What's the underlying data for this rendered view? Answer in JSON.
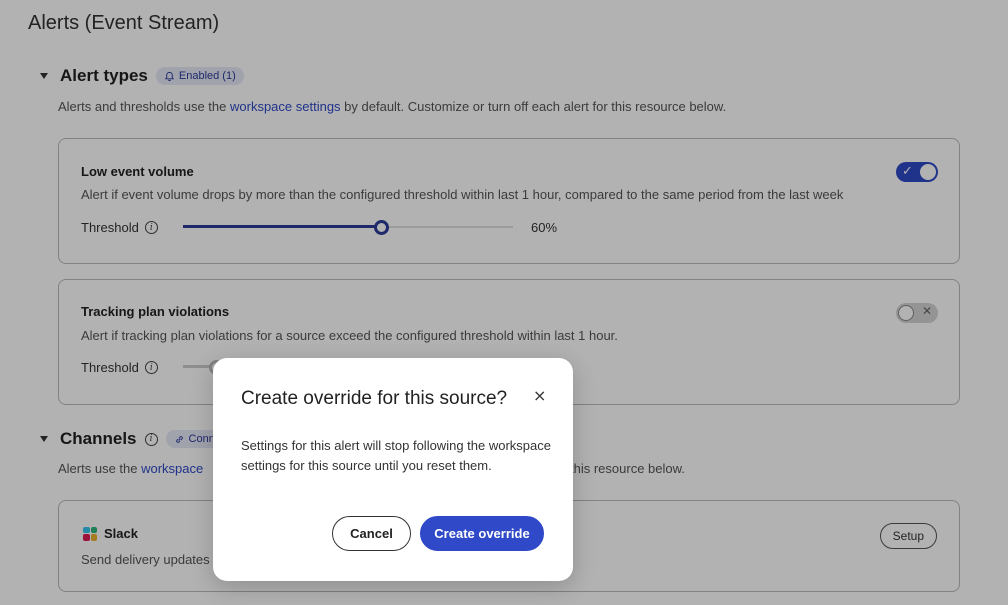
{
  "page": {
    "title": "Alerts (Event Stream)"
  },
  "alert_types": {
    "title": "Alert types",
    "badge": "Enabled (1)",
    "desc_before": "Alerts and thresholds use the ",
    "desc_link": "workspace settings",
    "desc_after": " by default. Customize or turn off each alert for this resource below.",
    "cards": [
      {
        "title": "Low event volume",
        "desc": "Alert if event volume drops by more than the configured threshold within last 1 hour, compared to the same period from the last week",
        "threshold_label": "Threshold",
        "threshold_value": "60%",
        "threshold_fraction": 0.6,
        "enabled": true,
        "toggle_glyph": "✓"
      },
      {
        "title": "Tracking plan violations",
        "desc": "Alert if tracking plan violations for a source exceed the configured threshold within last 1 hour.",
        "threshold_label": "Threshold",
        "threshold_fraction": 0.1,
        "enabled": false,
        "toggle_glyph": "✕"
      }
    ]
  },
  "channels": {
    "title": "Channels",
    "badge": "Conn",
    "desc_before": "Alerts use the ",
    "desc_link": "workspace",
    "desc_after": "this resource below.",
    "slack": {
      "name": "Slack",
      "desc": "Send delivery updates",
      "setup_label": "Setup"
    }
  },
  "modal": {
    "title": "Create override for this source?",
    "close_glyph": "×",
    "body": "Settings for this alert will stop following the workspace settings for this source until you reset them.",
    "cancel_label": "Cancel",
    "confirm_label": "Create override"
  },
  "colors": {
    "accent": "#2f49c8",
    "accent_dark": "#2b3a99",
    "overlay": "rgba(0,0,0,0.30)"
  }
}
